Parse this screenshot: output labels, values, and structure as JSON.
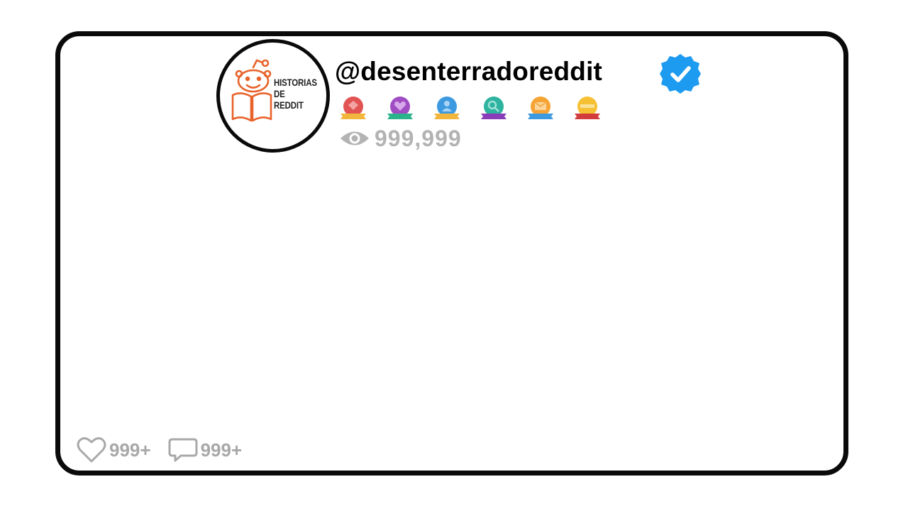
{
  "profile": {
    "logo_lines": [
      "HISTORIAS",
      "DE",
      "REDDIT"
    ],
    "username": "@desenterradoreddit",
    "verified_icon": "verified-check-icon",
    "verified_color": "#1d9bf0"
  },
  "badges": [
    {
      "icon": "diamond-badge-icon",
      "color": "#e25454",
      "ribbon": "#f2b63c"
    },
    {
      "icon": "heart-badge-icon",
      "color": "#a04cc2",
      "ribbon": "#2bb38c"
    },
    {
      "icon": "person-badge-icon",
      "color": "#3d9ae0",
      "ribbon": "#f2b63c"
    },
    {
      "icon": "search-badge-icon",
      "color": "#2eb3a0",
      "ribbon": "#8a3db8"
    },
    {
      "icon": "envelope-badge-icon",
      "color": "#f5a434",
      "ribbon": "#3d9ae0"
    },
    {
      "icon": "minus-badge-icon",
      "color": "#f5c033",
      "ribbon": "#d33c3c"
    }
  ],
  "stats": {
    "views": "999,999",
    "likes": "999+",
    "comments": "999+"
  },
  "colors": {
    "logo_orange": "#e8622a",
    "stat_gray": "#b3b3b3"
  }
}
